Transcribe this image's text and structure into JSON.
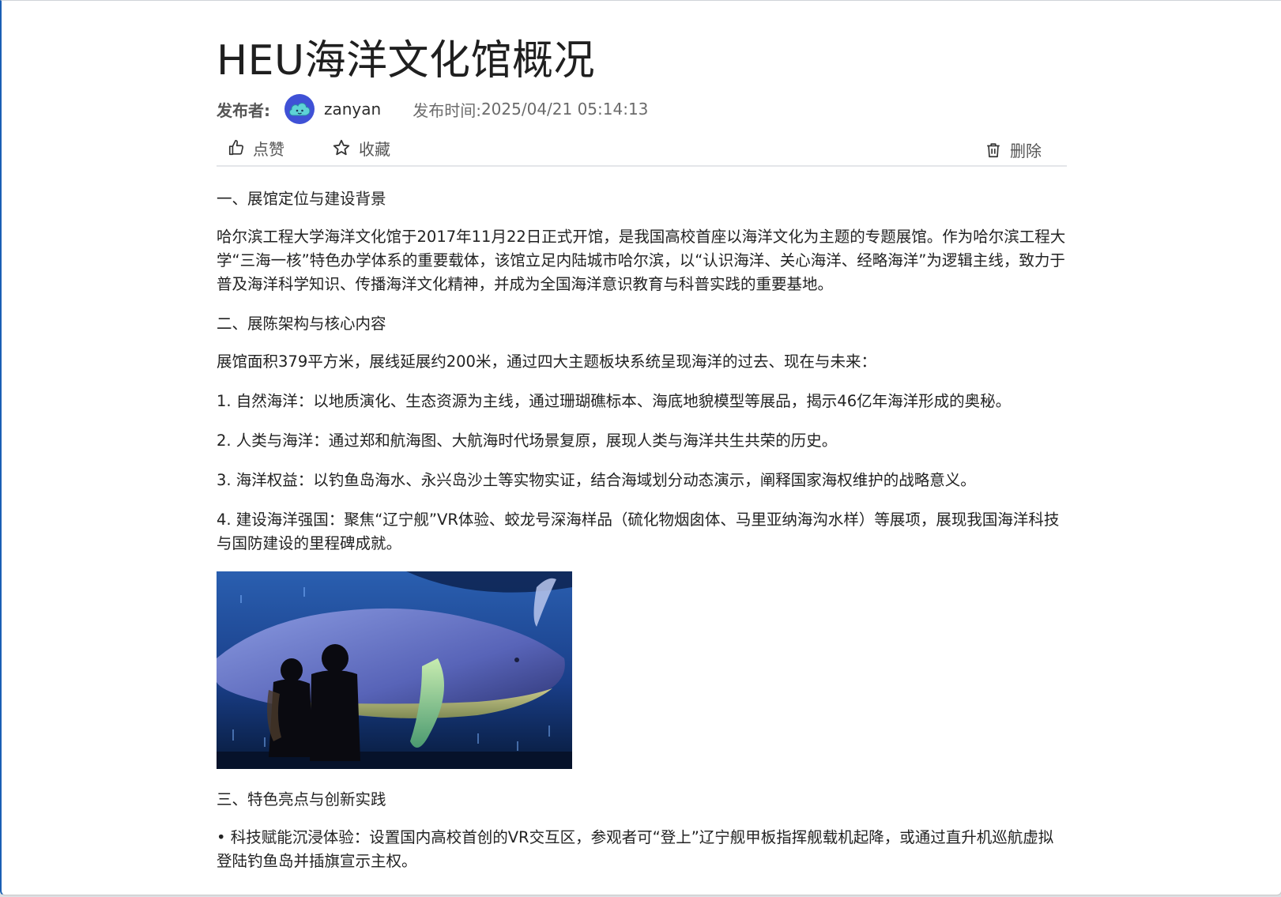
{
  "article": {
    "title": "HEU海洋文化馆概况",
    "publisher_label": "发布者:",
    "author": "zanyan",
    "time_label": "发布时间:",
    "time_value": "2025/04/21 05:14:13"
  },
  "actions": {
    "like_label": "点赞",
    "favorite_label": "收藏",
    "delete_label": "删除"
  },
  "content": {
    "section1_heading": "一、展馆定位与建设背景",
    "section1_para": "哈尔滨工程大学海洋文化馆于2017年11月22日正式开馆，是我国高校首座以海洋文化为主题的专题展馆。作为哈尔滨工程大学“三海一核”特色办学体系的重要载体，该馆立足内陆城市哈尔滨，以“认识海洋、关心海洋、经略海洋”为逻辑主线，致力于普及海洋科学知识、传播海洋文化精神，并成为全国海洋意识教育与科普实践的重要基地。",
    "section2_heading": "二、展陈架构与核心内容",
    "section2_intro": "展馆面积379平方米，展线延展约200米，通过四大主题板块系统呈现海洋的过去、现在与未来：",
    "item1": "1. 自然海洋：以地质演化、生态资源为主线，通过珊瑚礁标本、海底地貌模型等展品，揭示46亿年海洋形成的奥秘。",
    "item2": "2. 人类与海洋：通过郑和航海图、大航海时代场景复原，展现人类与海洋共生共荣的历史。",
    "item3": "3. 海洋权益：以钓鱼岛海水、永兴岛沙土等实物实证，结合海域划分动态演示，阐释国家海权维护的战略意义。",
    "item4": "4. 建设海洋强国：聚焦“辽宁舰”VR体验、蛟龙号深海样品（硫化物烟囱体、马里亚纳海沟水样）等展项，展现我国海洋科技与国防建设的里程碑成就。",
    "section3_heading": "三、特色亮点与创新实践",
    "bullet1": "• 科技赋能沉浸体验：设置国内高校首创的VR交互区，参观者可“登上”辽宁舰甲板指挥舰载机起降，或通过直升机巡航虚拟登陆钓鱼岛并插旗宣示主权。"
  },
  "icons": {
    "like": "thumbs-up-icon",
    "favorite": "star-icon",
    "delete": "trash-icon",
    "avatar": "cloud-avatar-icon"
  },
  "colors": {
    "avatar_bg": "#3f51d6",
    "window_accent": "#1a5fb4"
  }
}
